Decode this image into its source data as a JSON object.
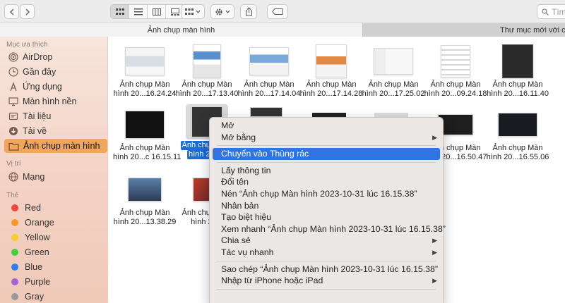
{
  "toolbar": {
    "back_icon": "chevron-left",
    "forward_icon": "chevron-right",
    "search_placeholder": "Tìm"
  },
  "tabs": [
    {
      "label": "Ảnh chụp màn hình",
      "active": true
    },
    {
      "label": "Thư mục mới với các m",
      "active": false
    }
  ],
  "sidebar": {
    "favorites_title": "Mục ưa thích",
    "favorites": [
      {
        "label": "AirDrop",
        "icon": "airdrop-icon"
      },
      {
        "label": "Gần đây",
        "icon": "clock-icon"
      },
      {
        "label": "Ứng dụng",
        "icon": "apps-icon"
      },
      {
        "label": "Màn hình nền",
        "icon": "desktop-icon"
      },
      {
        "label": "Tài liệu",
        "icon": "document-icon"
      },
      {
        "label": "Tải về",
        "icon": "download-icon"
      },
      {
        "label": "Ảnh chụp màn hình",
        "icon": "folder-icon",
        "selected": true
      }
    ],
    "locations_title": "Vị trí",
    "locations": [
      {
        "label": "Mạng",
        "icon": "network-icon"
      }
    ],
    "tags_title": "Thẻ",
    "tags": [
      {
        "label": "Red",
        "color": "#f0473d"
      },
      {
        "label": "Orange",
        "color": "#f59a2a"
      },
      {
        "label": "Yellow",
        "color": "#f5cf2a"
      },
      {
        "label": "Green",
        "color": "#3ccf3c"
      },
      {
        "label": "Blue",
        "color": "#2d7ff0"
      },
      {
        "label": "Purple",
        "color": "#a95fd6"
      },
      {
        "label": "Gray",
        "color": "#9a9a9a"
      }
    ]
  },
  "files": [
    {
      "line1": "Ảnh chụp Màn",
      "line2": "hình 20...16.24.24"
    },
    {
      "line1": "Ảnh chụp Màn",
      "line2": "hình 20...17.13.40"
    },
    {
      "line1": "Ảnh chụp Màn",
      "line2": "hình 20...17.14.04"
    },
    {
      "line1": "Ảnh chụp Màn",
      "line2": "hình 20...17.14.28"
    },
    {
      "line1": "Ảnh chụp Màn",
      "line2": "hình 20...17.25.02"
    },
    {
      "line1": "Ảnh chụp Màn",
      "line2": "hình 20...09.24.18"
    },
    {
      "line1": "Ảnh chụp Màn",
      "line2": "hình 20...16.11.40"
    },
    {
      "line1": "Ảnh chụp Màn",
      "line2": "hình 20...c 16.15.11"
    },
    {
      "line1": "Ảnh chụp Màn",
      "line2": "hình 20...1",
      "selected": true
    },
    {
      "line1": "Ảnh chụp Màn",
      "line2": "hình 20...16.50.47"
    },
    {
      "line1": "Ảnh chụp Màn",
      "line2": "hình 20...16.55.06"
    },
    {
      "line1": "Ảnh chụp Màn",
      "line2": "hình 20...13.38.29"
    },
    {
      "line1": "Ảnh chụp Màn",
      "line2": "hình 20..."
    }
  ],
  "context_menu": {
    "items": [
      {
        "label": "Mở"
      },
      {
        "label": "Mở bằng",
        "submenu": true
      },
      {
        "separator": true
      },
      {
        "label": "Chuyển vào Thùng rác",
        "highlight": true
      },
      {
        "separator": true
      },
      {
        "label": "Lấy thông tin"
      },
      {
        "label": "Đổi tên"
      },
      {
        "label": "Nén “Ảnh chụp Màn hình 2023-10-31 lúc 16.15.38”"
      },
      {
        "label": "Nhân bản"
      },
      {
        "label": "Tạo biệt hiệu"
      },
      {
        "label": "Xem nhanh “Ảnh chụp Màn hình 2023-10-31 lúc 16.15.38”"
      },
      {
        "label": "Chia sẻ",
        "submenu": true
      },
      {
        "label": "Tác vụ nhanh",
        "submenu": true
      },
      {
        "separator": true
      },
      {
        "label": "Sao chép “Ảnh chụp Màn hình 2023-10-31 lúc 16.15.38”"
      },
      {
        "label": "Nhập từ iPhone hoặc iPad",
        "submenu": true
      },
      {
        "separator": true
      }
    ]
  },
  "colors": {
    "accent": "#2f74e0",
    "sidebar_selected": "#f1a65a",
    "file_selected": "#1a6cd9"
  }
}
